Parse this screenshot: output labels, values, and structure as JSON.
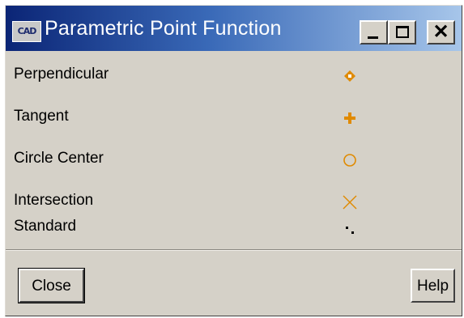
{
  "window": {
    "title": "Parametric Point Function",
    "icon_text": "CAD"
  },
  "title_buttons": {
    "minimize_icon": "minimize-icon",
    "maximize_icon": "maximize-icon",
    "close_glyph": "✕"
  },
  "rows": [
    {
      "label": "Perpendicular",
      "symbol": "diamond-icon",
      "color": "#e08a00"
    },
    {
      "label": "Tangent",
      "symbol": "plus-icon",
      "color": "#e08a00"
    },
    {
      "label": "Circle Center",
      "symbol": "circle-icon",
      "color": "#e08a00"
    },
    {
      "label": "Intersection",
      "symbol": "cross-icon",
      "color": "#e08a00"
    },
    {
      "label": "Standard",
      "symbol": "dot-icon",
      "color": "#000000"
    }
  ],
  "buttons": {
    "close_label": "Close",
    "help_label": "Help"
  }
}
